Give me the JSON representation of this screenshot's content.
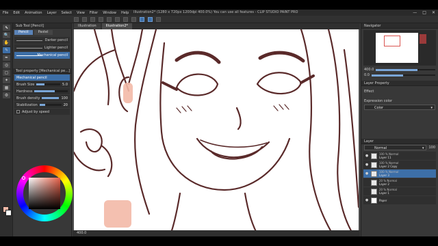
{
  "menu": [
    "File",
    "Edit",
    "Animation",
    "Layer",
    "Select",
    "View",
    "Filter",
    "Window",
    "Help"
  ],
  "window_title": "Illustration2* (1280 x 720px 1200dpi 400.0%)  You can use all features - CLIP STUDIO PAINT PRO",
  "window_controls": [
    "—",
    "□",
    "✕"
  ],
  "tools": [
    "⬉",
    "🔍",
    "✋",
    "✎",
    "✒",
    "◎",
    "▢",
    "✦",
    "▦",
    "⚙"
  ],
  "subtool": {
    "header": "Sub Tool [Pencil]",
    "tabs": [
      "Pencil",
      "Pastel"
    ],
    "brushes": [
      "Darker pencil",
      "Lighter pencil",
      "Mechanical pencil"
    ],
    "property_header": "Tool property [Mechanical pe...]",
    "property_name": "Mechanical pencil",
    "props": [
      {
        "label": "Brush Size",
        "value": "5.0",
        "fill": 0.35
      },
      {
        "label": "Hardness",
        "value": "",
        "fill": 0.6
      },
      {
        "label": "Brush density",
        "value": "100",
        "fill": 1.0
      },
      {
        "label": "Stabilization",
        "value": "20",
        "fill": 0.25
      }
    ],
    "adjust_speed_label": "Adjust by speed"
  },
  "colors": {
    "main": "#f3b9a7",
    "sub": "#ffffff",
    "accent": "#3d6fa8"
  },
  "doc_tabs": [
    "Illustration",
    "Illustration2*"
  ],
  "status_text": "400.0",
  "navigator": {
    "title": "Navigator",
    "zoom": "400.0",
    "rotation": "0.0"
  },
  "layer_property": {
    "title": "Layer Property",
    "effect_label": "Effect",
    "expression_label": "Expression color",
    "expression_value": "Color"
  },
  "layers": {
    "title": "Layer",
    "blend_mode": "Normal",
    "opacity": "100",
    "items": [
      {
        "blend": "100 % Normal",
        "name": "Layer 11",
        "selected": false
      },
      {
        "blend": "100 % Normal",
        "name": "Layer 2 Copy",
        "selected": false
      },
      {
        "blend": "100 % Normal",
        "name": "Layer 3",
        "selected": true
      },
      {
        "blend": "20 % Normal",
        "name": "Layer 2",
        "selected": false
      },
      {
        "blend": "20 % Normal",
        "name": "Layer 1",
        "selected": false
      },
      {
        "blend": "",
        "name": "Paper",
        "selected": false
      }
    ]
  }
}
